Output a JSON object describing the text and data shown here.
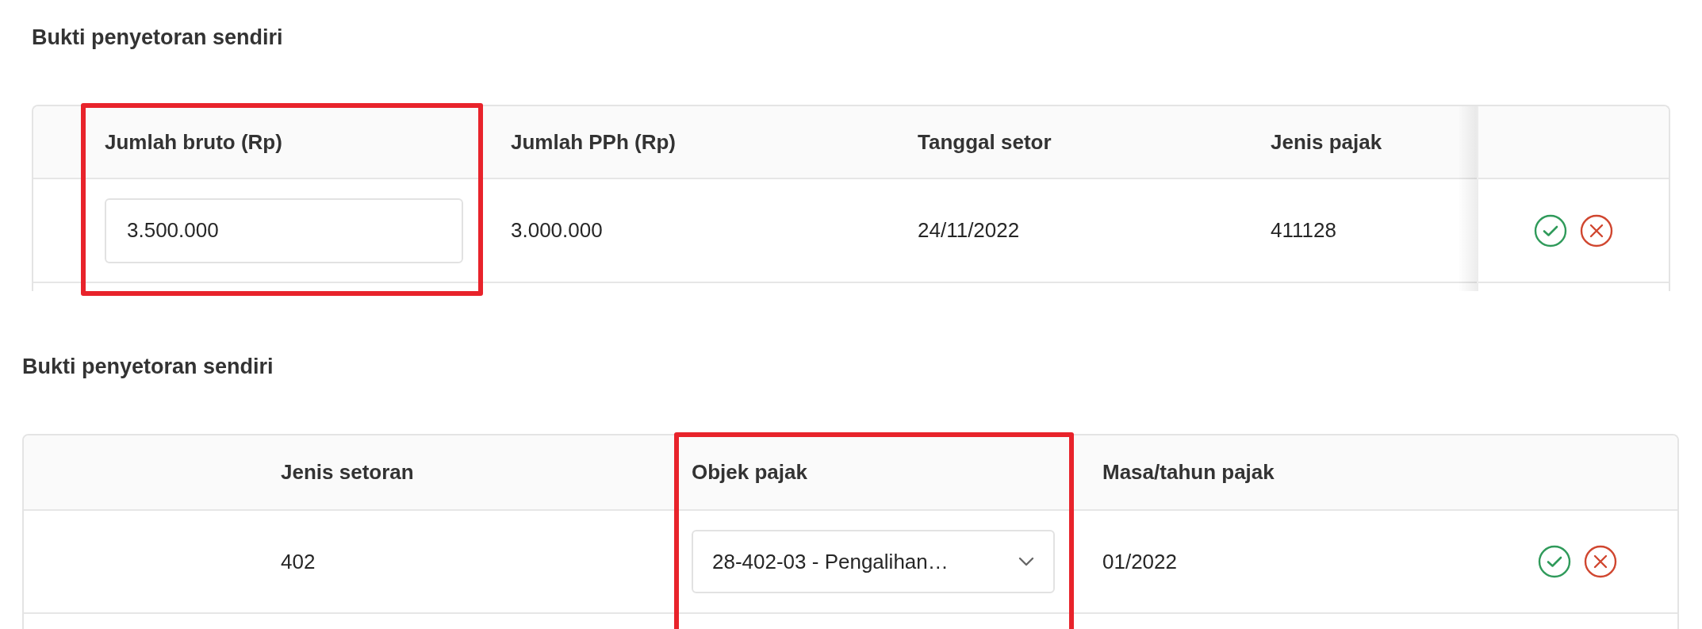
{
  "sections": [
    {
      "title": "Bukti penyetoran sendiri",
      "table": {
        "pinned_actions": true,
        "columns": [
          {
            "kind": "blank",
            "highlighted": false
          },
          {
            "kind": "data",
            "header": "Jumlah bruto (Rp)",
            "highlighted": true
          },
          {
            "kind": "data",
            "header": "Jumlah PPh (Rp)",
            "highlighted": false
          },
          {
            "kind": "data",
            "header": "Tanggal setor",
            "highlighted": false
          },
          {
            "kind": "data",
            "header": "Jenis pajak",
            "highlighted": false
          },
          {
            "kind": "actions",
            "highlighted": false
          }
        ],
        "rows": [
          {
            "cells": [
              {
                "kind": "blank"
              },
              {
                "kind": "input",
                "value": "3.500.000"
              },
              {
                "kind": "text",
                "value": "3.000.000"
              },
              {
                "kind": "text",
                "value": "24/11/2022"
              },
              {
                "kind": "text",
                "value": "411128"
              },
              {
                "kind": "actions",
                "actions": [
                  {
                    "kind": "confirm"
                  },
                  {
                    "kind": "cancel"
                  }
                ]
              }
            ]
          }
        ]
      }
    },
    {
      "title": "Bukti penyetoran sendiri",
      "table": {
        "pinned_actions": false,
        "columns": [
          {
            "kind": "blank",
            "highlighted": false
          },
          {
            "kind": "data",
            "header": "Jenis setoran",
            "highlighted": false
          },
          {
            "kind": "data",
            "header": "Objek pajak",
            "highlighted": true
          },
          {
            "kind": "data",
            "header": "Masa/tahun pajak",
            "highlighted": false
          },
          {
            "kind": "actions",
            "highlighted": false
          }
        ],
        "rows": [
          {
            "cells": [
              {
                "kind": "blank"
              },
              {
                "kind": "text",
                "value": "402"
              },
              {
                "kind": "select",
                "value": "28-402-03 - Pengalihan…"
              },
              {
                "kind": "text",
                "value": "01/2022"
              },
              {
                "kind": "actions",
                "actions": [
                  {
                    "kind": "confirm"
                  },
                  {
                    "kind": "cancel"
                  }
                ]
              }
            ]
          }
        ]
      }
    }
  ]
}
